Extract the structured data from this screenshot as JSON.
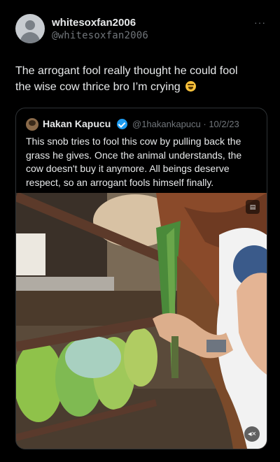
{
  "post": {
    "display_name": "whitesoxfan2006",
    "handle": "@whitesoxfan2006",
    "text": "The arrogant fool really thought he could fool the wise cow thrice bro I’m crying"
  },
  "quote": {
    "display_name": "Hakan Kapucu",
    "handle_date": "@1hakankapucu · 10/2/23",
    "text": "This snob tries to fool this cow by pulling back the grass he gives. Once the animal understands, the cow doesn't buy it anymore. All beings deserve respect, so an arrogant fools himself finally."
  },
  "icons": {
    "more": "more-icon",
    "verified": "verified-badge-icon",
    "gif": "gif-icon",
    "mute": "mute-icon",
    "emoji": "crying-laughing-emoji"
  },
  "colors": {
    "background": "#000000",
    "text": "#e7e9ea",
    "secondary": "#71767b",
    "border": "#2f3336",
    "verified": "#1d9bf0"
  }
}
